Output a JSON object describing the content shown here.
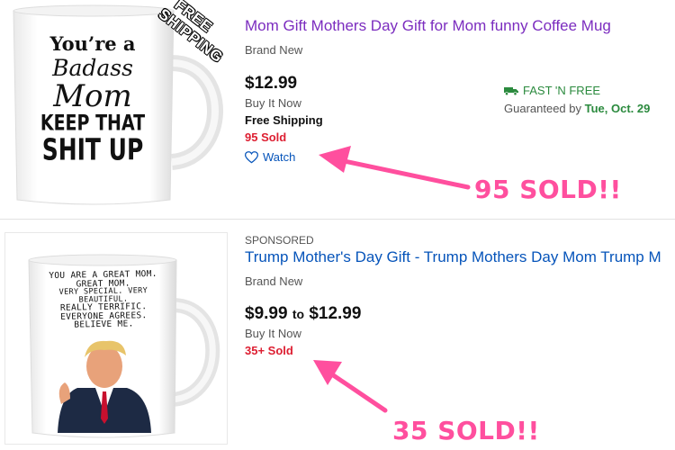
{
  "listings": [
    {
      "title": "Mom Gift Mothers Day Gift for Mom funny Coffee Mug",
      "condition": "Brand New",
      "price": "$12.99",
      "format": "Buy It Now",
      "shipping": "Free Shipping",
      "sold": "95 Sold",
      "watch_label": "Watch",
      "fast_label": "FAST 'N FREE",
      "guarantee_prefix": "Guaranteed by",
      "guarantee_date": "Tue, Oct. 29",
      "mug_text": [
        "You’re a",
        "Badass",
        "Mom",
        "KEEP THAT",
        "SHIT UP"
      ],
      "ribbon_text": [
        "FREE",
        "SHIPPING"
      ]
    },
    {
      "sponsored": "SPONSORED",
      "title": "Trump Mother's Day Gift - Trump Mothers Day Mom Trump M",
      "condition": "Brand New",
      "price_low": "$9.99",
      "price_to": "to",
      "price_high": "$12.99",
      "format": "Buy It Now",
      "sold": "35+ Sold",
      "mug_text": [
        "YOU ARE A GREAT MOM.",
        "GREAT MOM.",
        "VERY SPECIAL. VERY BEAUTIFUL.",
        "REALLY TERRIFIC.",
        "EVERYONE AGREES.",
        "BELIEVE ME."
      ]
    }
  ],
  "annotations": {
    "first": "95 SOLD!!",
    "second": "35 SOLD!!",
    "color": "#ff4f9e"
  },
  "colors": {
    "visited_link": "#7b2cbf",
    "link": "#0654ba",
    "sold": "#dd1e31",
    "fast": "#2b8a3e"
  }
}
